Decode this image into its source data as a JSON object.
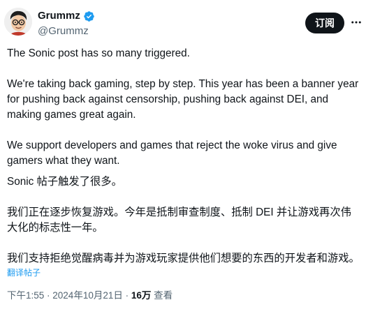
{
  "author": {
    "display_name": "Grummz",
    "handle": "@Grummz",
    "verified": true,
    "verified_color": "#1d9bf0"
  },
  "header": {
    "subscribe_label": "订阅",
    "more_icon": "more-horizontal-icon"
  },
  "tweet": {
    "paragraphs_en": [
      "The Sonic post has so many triggered.",
      "We're taking back gaming, step by step. This year has been a banner year for pushing back against censorship, pushing back against DEI, and making games great again.",
      "We support developers and games that reject the woke virus and give gamers what they want."
    ],
    "paragraphs_zh": [
      "Sonic 帖子触发了很多。",
      "我们正在逐步恢复游戏。今年是抵制审查制度、抵制 DEI 并让游戏再次伟大化的标志性一年。",
      "我们支持拒绝觉醒病毒并为游戏玩家提供他们想要的东西的开发者和游戏。"
    ],
    "translate_label": "翻译帖子"
  },
  "meta": {
    "time": "下午1:55",
    "separator": " · ",
    "date": "2024年10月21日",
    "views_count": "16万",
    "views_label": " 查看"
  },
  "colors": {
    "text": "#0f1419",
    "secondary": "#536471",
    "link": "#1d9bf0",
    "button_bg": "#0f1419"
  }
}
